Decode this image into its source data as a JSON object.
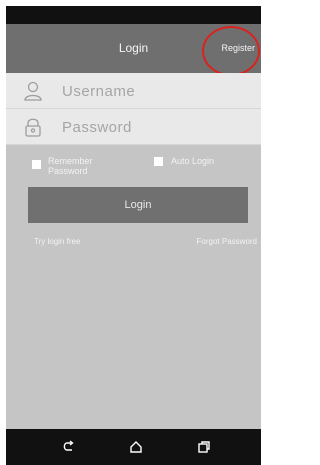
{
  "header": {
    "title": "Login",
    "register_label": "Register"
  },
  "form": {
    "username_placeholder": "Username",
    "password_placeholder": "Password",
    "remember_label": "Remember Password",
    "auto_login_label": "Auto Login",
    "login_button_label": "Login"
  },
  "links": {
    "try_free": "Try login free",
    "forgot_password": "Forgot Password"
  },
  "icons": {
    "username": "user-icon",
    "password": "lock-icon",
    "nav": [
      "back-icon",
      "home-icon",
      "recents-icon"
    ]
  },
  "colors": {
    "highlight": "#d9231f",
    "title_bar": "#6f6f6f",
    "login_button": "#707070"
  }
}
